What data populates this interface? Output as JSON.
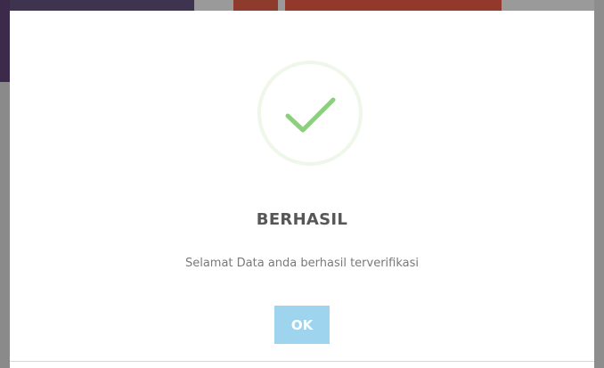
{
  "dialog": {
    "icon": "check-icon",
    "title": "BERHASIL",
    "message": "Selamat Data anda berhasil terverifikasi",
    "ok_label": "OK"
  },
  "colors": {
    "check": "#8ccf7e",
    "icon_ring": "#eef7e9",
    "ok_button": "#9fd4ee",
    "title": "#575757",
    "message": "#797979"
  }
}
